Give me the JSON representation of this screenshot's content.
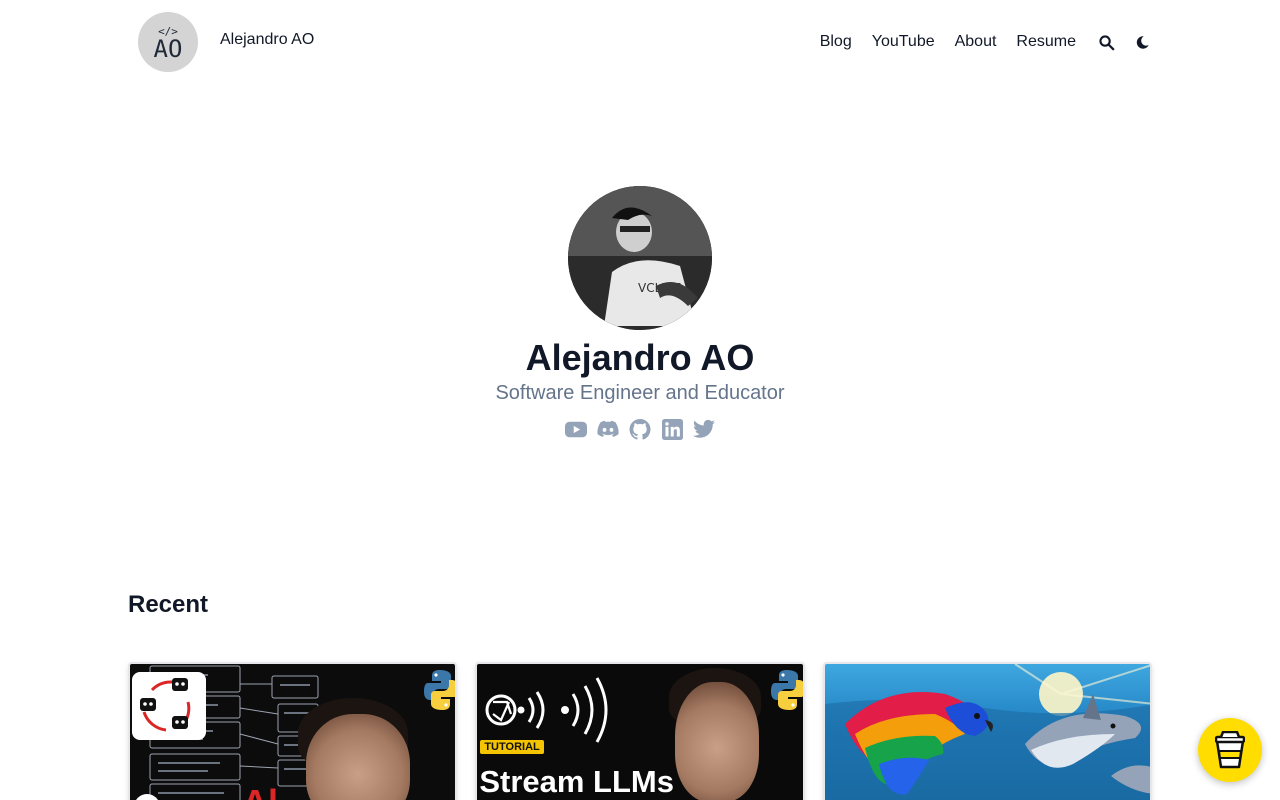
{
  "header": {
    "logo_code": "</>",
    "logo_initials": "AO",
    "site_title": "Alejandro AO",
    "nav": [
      "Blog",
      "YouTube",
      "About",
      "Resume"
    ]
  },
  "hero": {
    "name": "Alejandro AO",
    "tagline": "Software Engineer and Educator",
    "socials": [
      "youtube-icon",
      "discord-icon",
      "github-icon",
      "linkedin-icon",
      "twitter-icon"
    ]
  },
  "recent": {
    "heading": "Recent",
    "cards": [
      {
        "thumbnail_text": "Al"
      },
      {
        "badge": "TUTORIAL",
        "thumbnail_text": "Stream LLMs"
      },
      {}
    ]
  },
  "colors": {
    "text": "#111827",
    "muted": "#64748b",
    "social_icon": "#94a3b8",
    "coffee_button": "#ffdd00",
    "tutorial_badge": "#f5c400"
  }
}
